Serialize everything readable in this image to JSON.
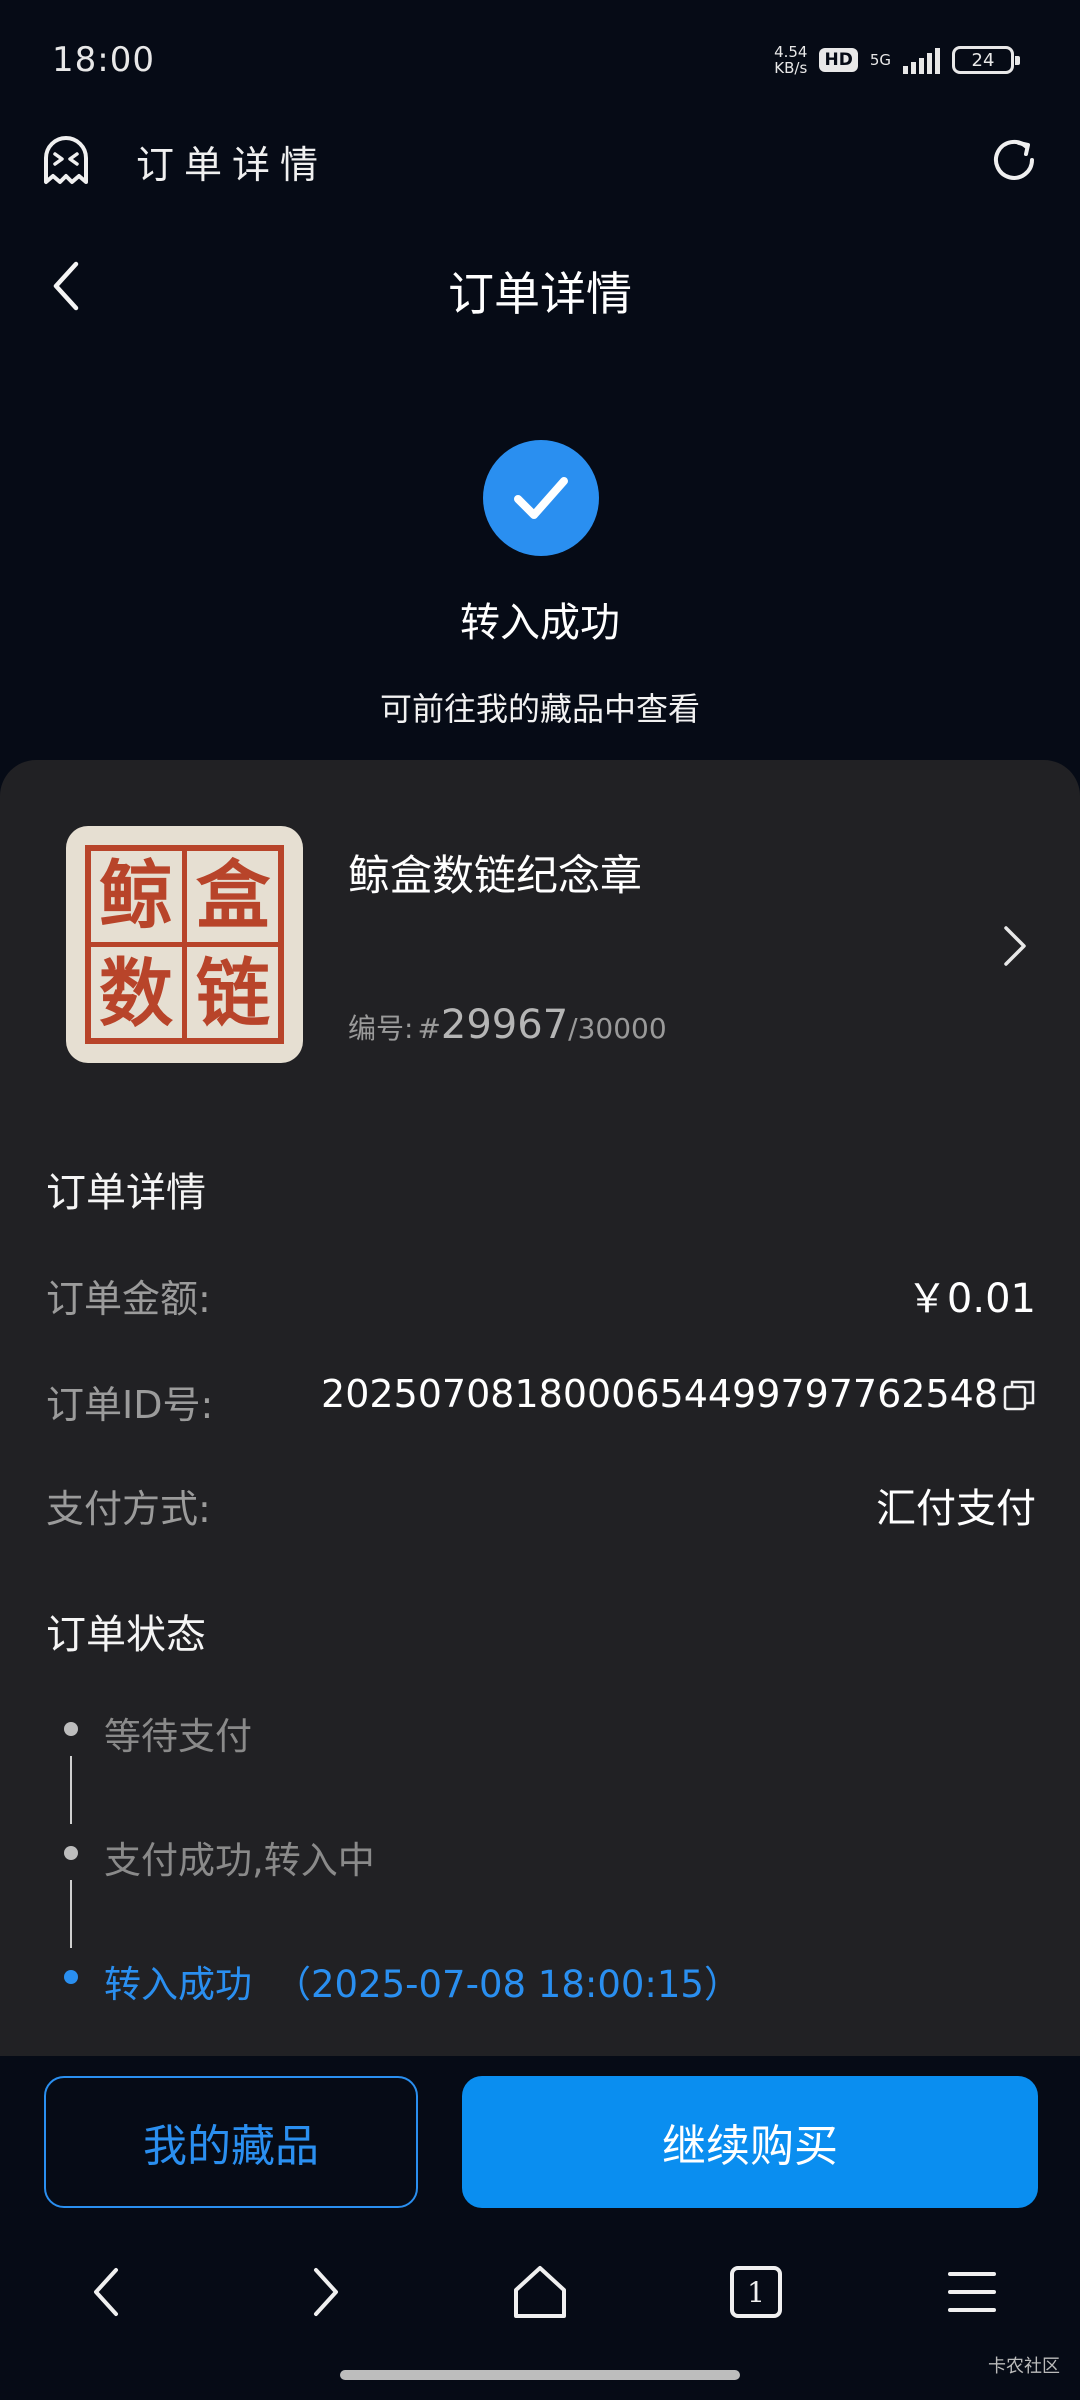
{
  "status_bar": {
    "time": "18:00",
    "net_speed_value": "4.54",
    "net_speed_unit": "KB/s",
    "hd_badge": "HD",
    "network": "5G",
    "battery": "24"
  },
  "browser": {
    "title": "订单详情"
  },
  "header": {
    "title": "订单详情"
  },
  "success": {
    "title": "转入成功",
    "subtitle": "可前往我的藏品中查看"
  },
  "product": {
    "name": "鲸盒数链纪念章",
    "serial_label": "编号:",
    "serial_hash": "#",
    "serial_number": "29967",
    "serial_total": "/30000",
    "seal_chars": [
      "鲸",
      "盒",
      "数",
      "链"
    ]
  },
  "order_details": {
    "section_title": "订单详情",
    "rows": [
      {
        "label": "订单金额:",
        "value": "￥0.01"
      },
      {
        "label": "订单ID号:",
        "value": "2025070818000654499797762548"
      },
      {
        "label": "支付方式:",
        "value": "汇付支付"
      }
    ]
  },
  "order_status": {
    "section_title": "订单状态",
    "steps": [
      {
        "text": "等待支付",
        "active": false
      },
      {
        "text": "支付成功,转入中",
        "active": false
      },
      {
        "text": "转入成功",
        "time": "（2025-07-08 18:00:15）",
        "active": true
      }
    ]
  },
  "actions": {
    "collection_label": "我的藏品",
    "buy_label": "继续购买"
  },
  "nav": {
    "tab_count": "1"
  },
  "watermark": "卡农社区",
  "colors": {
    "background": "#060b16",
    "card": "#212124",
    "accent": "#2a8ff0",
    "button": "#0a8ef0",
    "seal": "#b8442a"
  }
}
